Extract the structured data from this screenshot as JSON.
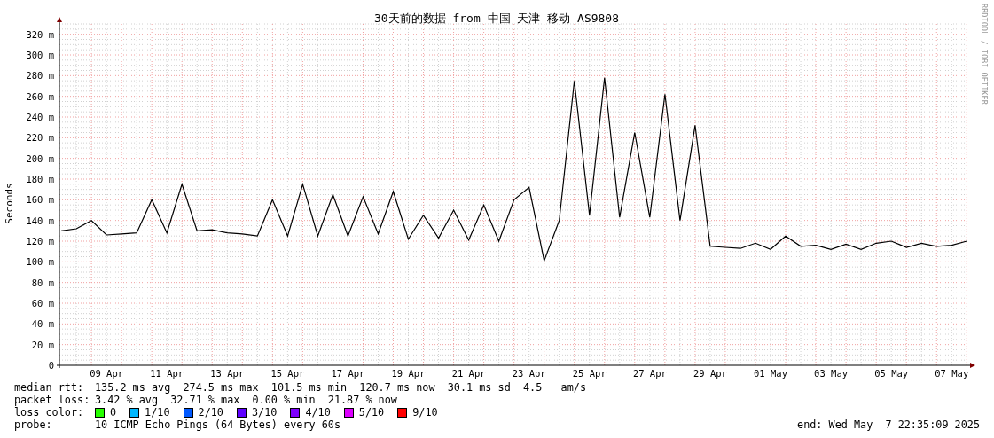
{
  "credit": "RRDTOOL / TOBI OETIKER",
  "chart": {
    "chart_data": {
      "type": "line",
      "title": "30天前的数据 from 中国 天津 移动 AS9808",
      "ylabel": "Seconds",
      "ylim": [
        0,
        330
      ],
      "grid": true,
      "yticks": [
        {
          "value": 0,
          "label": "0"
        },
        {
          "value": 20,
          "label": "20 m"
        },
        {
          "value": 40,
          "label": "40 m"
        },
        {
          "value": 60,
          "label": "60 m"
        },
        {
          "value": 80,
          "label": "80 m"
        },
        {
          "value": 100,
          "label": "100 m"
        },
        {
          "value": 120,
          "label": "120 m"
        },
        {
          "value": 140,
          "label": "140 m"
        },
        {
          "value": 160,
          "label": "160 m"
        },
        {
          "value": 180,
          "label": "180 m"
        },
        {
          "value": 200,
          "label": "200 m"
        },
        {
          "value": 220,
          "label": "220 m"
        },
        {
          "value": 240,
          "label": "240 m"
        },
        {
          "value": 260,
          "label": "260 m"
        },
        {
          "value": 280,
          "label": "280 m"
        },
        {
          "value": 300,
          "label": "300 m"
        },
        {
          "value": 320,
          "label": "320 m"
        }
      ],
      "categories": [
        null,
        null,
        null,
        "09 Apr",
        null,
        null,
        null,
        "11 Apr",
        null,
        null,
        null,
        "13 Apr",
        null,
        null,
        null,
        "15 Apr",
        null,
        null,
        null,
        "17 Apr",
        null,
        null,
        null,
        "19 Apr",
        null,
        null,
        null,
        "21 Apr",
        null,
        null,
        null,
        "23 Apr",
        null,
        null,
        null,
        "25 Apr",
        null,
        null,
        null,
        "27 Apr",
        null,
        null,
        null,
        "29 Apr",
        null,
        null,
        null,
        "01 May",
        null,
        null,
        null,
        "03 May",
        null,
        null,
        null,
        "05 May",
        null,
        null,
        null,
        "07 May",
        null
      ],
      "series": [
        {
          "color": "#000000",
          "values": [
            130,
            132,
            140,
            126,
            127,
            128,
            160,
            128,
            175,
            130,
            131,
            128,
            127,
            125,
            160,
            125,
            175,
            125,
            165,
            125,
            163,
            127,
            168,
            122,
            145,
            123,
            150,
            121,
            155,
            120,
            160,
            172,
            101,
            140,
            275,
            145,
            278,
            143,
            225,
            143,
            262,
            140,
            232,
            115,
            114,
            113,
            118,
            112,
            125,
            115,
            116,
            112,
            117,
            112,
            118,
            120,
            114,
            118,
            115,
            116,
            120
          ]
        }
      ]
    }
  },
  "legend": [
    {
      "label": "median rtt:",
      "text": "135.2 ms avg  274.5 ms max  101.5 ms min  120.7 ms now  30.1 ms sd  4.5   am/s"
    },
    {
      "label": "packet loss:",
      "text": "3.42 % avg  32.71 % max  0.00 % min  21.87 % now"
    }
  ],
  "loss_colors": {
    "label": "loss color:",
    "items": [
      {
        "label": "0",
        "color": "#26ff00"
      },
      {
        "label": "1/10",
        "color": "#00b8ff"
      },
      {
        "label": "2/10",
        "color": "#0059ff"
      },
      {
        "label": "3/10",
        "color": "#5e00ff"
      },
      {
        "label": "4/10",
        "color": "#7e00ff"
      },
      {
        "label": "5/10",
        "color": "#dd00ff"
      },
      {
        "label": "9/10",
        "color": "#ff0000"
      }
    ]
  },
  "probe": {
    "label": "probe:",
    "text": "10 ICMP Echo Pings (64 Bytes) every 60s",
    "end": "end: Wed May  7 22:35:09 2025"
  }
}
